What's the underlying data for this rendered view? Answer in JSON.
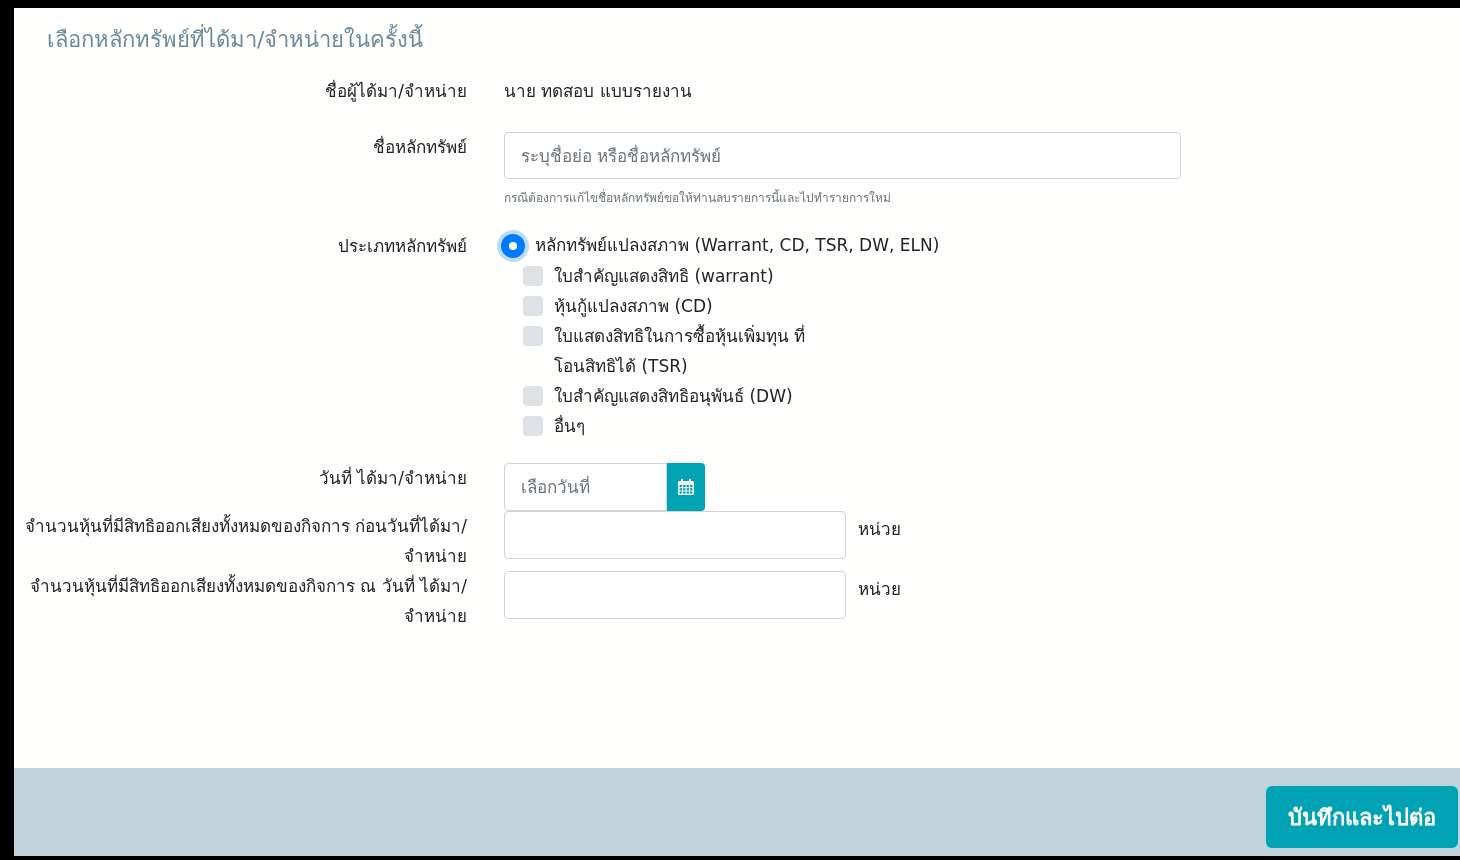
{
  "title": "เลือกหลักทรัพย์ที่ได้มา/จำหน่ายในครั้งนี้",
  "fields": [
    {
      "kind": "static",
      "label": "ชื่อผู้ได้มา/จำหน่าย",
      "value": "นาย ทดสอบ แบบรายงาน"
    },
    {
      "kind": "text",
      "label": "ชื่อหลักทรัพย์",
      "placeholder": "ระบุชื่อย่อ หรือชื่อหลักทรัพย์",
      "help": "กรณีต้องการแก้ไขชื่อหลักทรัพย์ขอให้ท่านลบรายการนี้และไปทำรายการใหม่"
    },
    {
      "kind": "type",
      "label": "ประเภทหลักทรัพย์",
      "radio": {
        "label": "หลักทรัพย์แปลงสภาพ (Warrant, CD, TSR, DW, ELN)",
        "selected": true
      },
      "options": [
        {
          "label": "ใบสำคัญแสดงสิทธิ (warrant)",
          "checked": false
        },
        {
          "label": "หุ้นกู้แปลงสภาพ (CD)",
          "checked": false
        },
        {
          "label": "ใบแสดงสิทธิในการซื้อหุ้นเพิ่มทุน ที่โอนสิทธิได้ (TSR)",
          "checked": false
        },
        {
          "label": "ใบสำคัญแสดงสิทธิอนุพันธ์ (DW)",
          "checked": false
        },
        {
          "label": "อื่นๆ",
          "checked": false
        }
      ]
    },
    {
      "kind": "date",
      "label": "วันที่ ได้มา/จำหน่าย",
      "placeholder": "เลือกวันที่"
    },
    {
      "kind": "number",
      "label": "จำนวนหุ้นที่มีสิทธิออกเสียงทั้งหมดของกิจการ ก่อนวันที่ได้มา/จำหน่าย",
      "unit": "หน่วย"
    },
    {
      "kind": "number",
      "label": "จำนวนหุ้นที่มีสิทธิออกเสียงทั้งหมดของกิจการ ณ วันที่ ได้มา/จำหน่าย",
      "unit": "หน่วย"
    }
  ],
  "submit": "บันทึกและไปต่อ"
}
